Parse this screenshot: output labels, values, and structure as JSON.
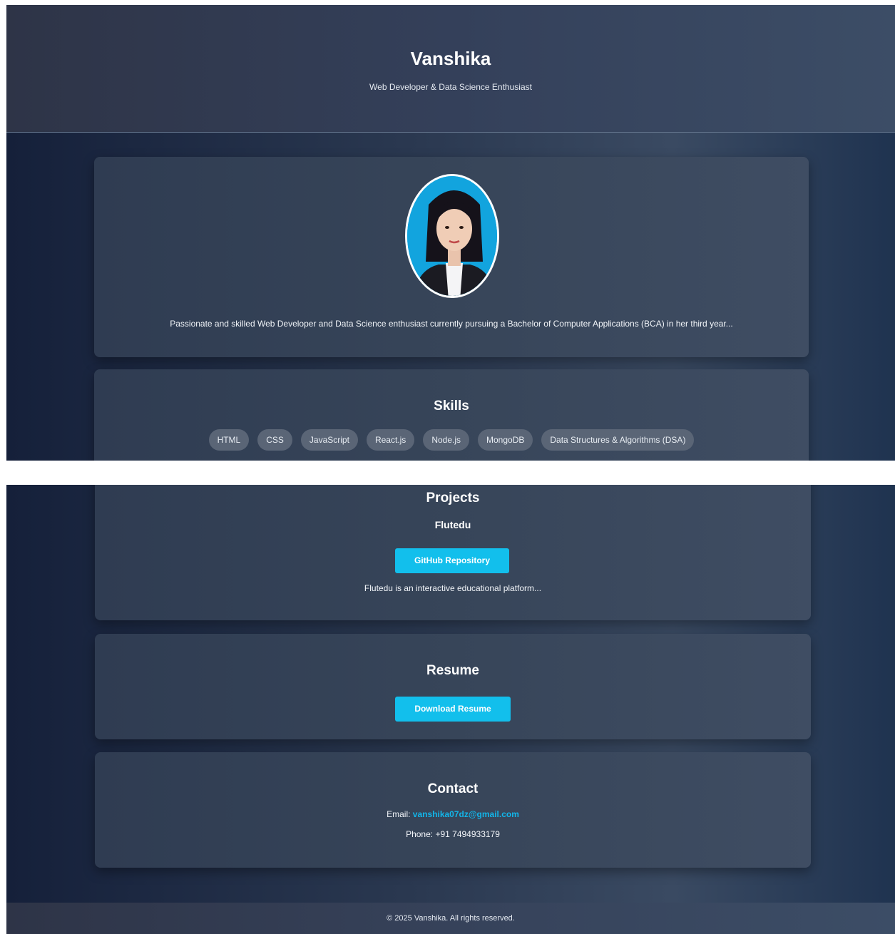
{
  "header": {
    "name": "Vanshika",
    "tagline": "Web Developer & Data Science Enthusiast"
  },
  "about": {
    "text": "Passionate and skilled Web Developer and Data Science enthusiast currently pursuing a Bachelor of Computer Applications (BCA) in her third year..."
  },
  "skills": {
    "title": "Skills",
    "items": [
      "HTML",
      "CSS",
      "JavaScript",
      "React.js",
      "Node.js",
      "MongoDB",
      "Data Structures & Algorithms (DSA)"
    ]
  },
  "projects": {
    "title": "Projects",
    "name": "Flutedu",
    "repo_label": "GitHub Repository",
    "description": "Flutedu is an interactive educational platform..."
  },
  "resume": {
    "title": "Resume",
    "download_label": "Download Resume"
  },
  "contact": {
    "title": "Contact",
    "email_label": "Email:",
    "email": "vanshika07dz@gmail.com",
    "phone_label": "Phone:",
    "phone": "+91 7494933179"
  },
  "footer": {
    "text": "© 2025 Vanshika. All rights reserved."
  },
  "colors": {
    "accent": "#12bfec",
    "link": "#12b6ea",
    "pill": "#5a6576",
    "card": "#374559"
  }
}
